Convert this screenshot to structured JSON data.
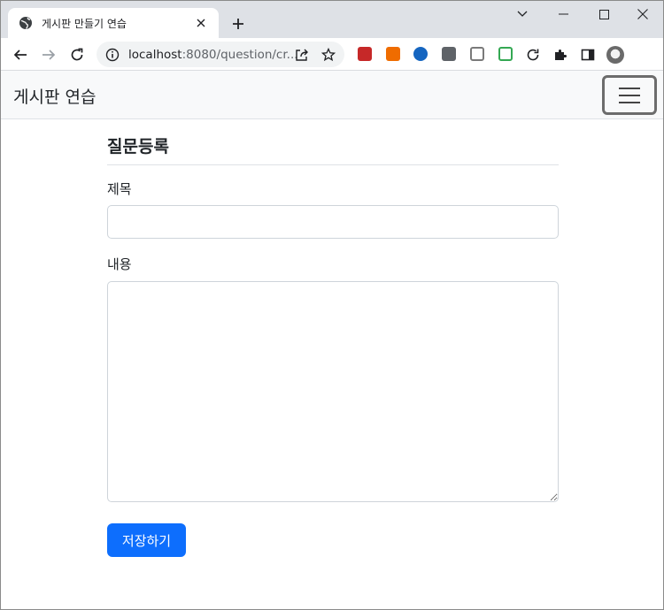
{
  "browser": {
    "tab_title": "게시판 만들기 연습",
    "url_host": "localhost",
    "url_rest": ":8080/question/cr...",
    "icons": [
      "globe-icon",
      "close-icon",
      "plus-icon",
      "back-arrow-icon",
      "forward-arrow-icon",
      "reload-icon",
      "info-icon",
      "share-icon",
      "star-icon",
      "puzzle-icon",
      "side-panel-icon",
      "minimize-icon",
      "maximize-icon",
      "window-close-icon",
      "chevron-down-icon"
    ],
    "extension_colors": [
      "#c62828",
      "#ef6c00",
      "#1565c0",
      "#5f6368",
      "#7a7a7a",
      "#34a853"
    ]
  },
  "navbar": {
    "brand": "게시판 연습"
  },
  "form": {
    "title": "질문등록",
    "subject_label": "제목",
    "subject_value": "",
    "content_label": "내용",
    "content_value": "",
    "save_label": "저장하기"
  },
  "colors": {
    "primary": "#0d6efd",
    "navbar_bg": "#f8f9fa",
    "tabstrip_bg": "#dee1e6"
  }
}
